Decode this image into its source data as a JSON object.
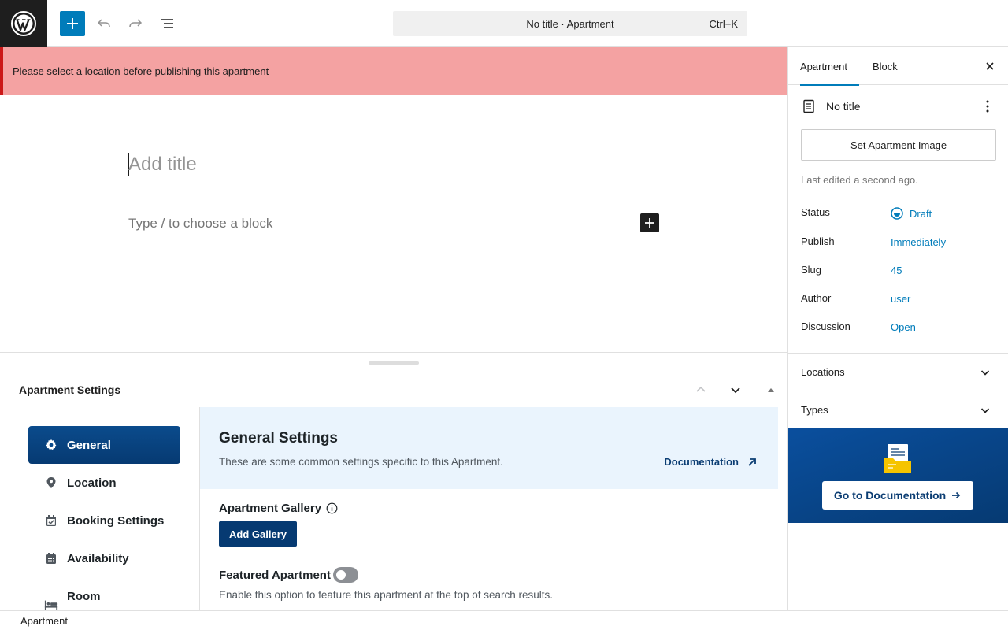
{
  "header": {
    "document_title": "No title · Apartment",
    "shortcut": "Ctrl+K"
  },
  "notice": {
    "message": "Please select a location before publishing this apartment"
  },
  "editor": {
    "title_placeholder": "Add title",
    "block_placeholder": "Type / to choose a block"
  },
  "metabox": {
    "title": "Apartment Settings",
    "nav": [
      {
        "label": "General",
        "icon": "gear-icon",
        "active": true
      },
      {
        "label": "Location",
        "icon": "map-pin-icon"
      },
      {
        "label": "Booking Settings",
        "icon": "calendar-check-icon"
      },
      {
        "label": "Availability",
        "icon": "calendar-icon"
      },
      {
        "label": "Room",
        "icon": "bed-icon"
      }
    ],
    "general": {
      "heading": "General Settings",
      "description": "These are some common settings specific to this Apartment.",
      "doc_link": "Documentation"
    },
    "gallery": {
      "label": "Apartment Gallery",
      "button": "Add Gallery"
    },
    "featured": {
      "label": "Featured Apartment",
      "enabled": false,
      "description": "Enable this option to feature this apartment at the top of search results."
    }
  },
  "sidebar": {
    "tabs": [
      "Apartment",
      "Block"
    ],
    "active_tab": "Apartment",
    "doc_title": "No title",
    "set_image": "Set Apartment Image",
    "last_edited": "Last edited a second ago.",
    "meta": [
      {
        "key": "Status",
        "value": "Draft"
      },
      {
        "key": "Publish",
        "value": "Immediately"
      },
      {
        "key": "Slug",
        "value": "45"
      },
      {
        "key": "Author",
        "value": "user"
      },
      {
        "key": "Discussion",
        "value": "Open"
      }
    ],
    "panels": [
      "Locations",
      "Types"
    ],
    "promo_button": "Go to Documentation"
  },
  "footer": {
    "breadcrumb": "Apartment"
  },
  "colors": {
    "accent": "#007cba",
    "notice_bg": "#f4a2a2",
    "notice_border": "#cc1818",
    "brand_dark": "#063a72"
  }
}
